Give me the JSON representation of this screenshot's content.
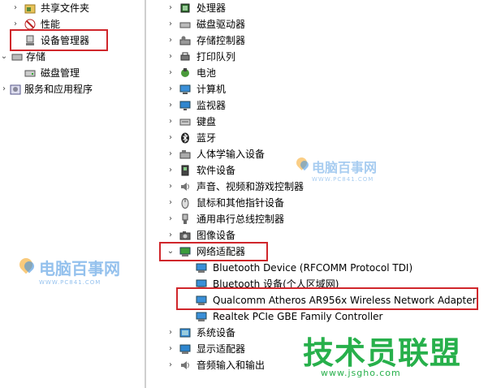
{
  "left_tree": {
    "items": [
      {
        "label": "共享文件夹",
        "icon": "shared-folder-icon",
        "expander": "›"
      },
      {
        "label": "性能",
        "icon": "performance-icon",
        "expander": "›"
      },
      {
        "label": "设备管理器",
        "icon": "device-manager-icon",
        "expander": ""
      },
      {
        "label": "存储",
        "icon": "storage-icon",
        "expander": "⌄"
      },
      {
        "label": "磁盘管理",
        "icon": "disk-management-icon",
        "expander": ""
      },
      {
        "label": "服务和应用程序",
        "icon": "services-icon",
        "expander": "›"
      }
    ]
  },
  "device_tree": {
    "categories": [
      {
        "label": "处理器",
        "icon": "processor-icon",
        "expander": "›"
      },
      {
        "label": "磁盘驱动器",
        "icon": "disk-drive-icon",
        "expander": "›"
      },
      {
        "label": "存储控制器",
        "icon": "storage-controller-icon",
        "expander": "›"
      },
      {
        "label": "打印队列",
        "icon": "print-queue-icon",
        "expander": "›"
      },
      {
        "label": "电池",
        "icon": "battery-icon",
        "expander": "›"
      },
      {
        "label": "计算机",
        "icon": "computer-icon",
        "expander": "›"
      },
      {
        "label": "监视器",
        "icon": "monitor-icon",
        "expander": "›"
      },
      {
        "label": "键盘",
        "icon": "keyboard-icon",
        "expander": "›"
      },
      {
        "label": "蓝牙",
        "icon": "bluetooth-icon",
        "expander": "›"
      },
      {
        "label": "人体学输入设备",
        "icon": "hid-icon",
        "expander": "›"
      },
      {
        "label": "软件设备",
        "icon": "software-device-icon",
        "expander": "›"
      },
      {
        "label": "声音、视频和游戏控制器",
        "icon": "sound-icon",
        "expander": "›"
      },
      {
        "label": "鼠标和其他指针设备",
        "icon": "mouse-icon",
        "expander": "›"
      },
      {
        "label": "通用串行总线控制器",
        "icon": "usb-icon",
        "expander": "›"
      },
      {
        "label": "图像设备",
        "icon": "imaging-icon",
        "expander": "›"
      },
      {
        "label": "网络适配器",
        "icon": "network-adapter-icon",
        "expander": "⌄"
      }
    ],
    "network_children": [
      {
        "label": "Bluetooth Device (RFCOMM Protocol TDI)",
        "icon": "network-adapter-icon"
      },
      {
        "label": "Bluetooth 设备(个人区域网)",
        "icon": "network-adapter-icon"
      },
      {
        "label": "Qualcomm Atheros AR956x Wireless Network Adapter",
        "icon": "network-adapter-icon"
      },
      {
        "label": "Realtek PCIe GBE Family Controller",
        "icon": "network-adapter-icon"
      }
    ],
    "after": [
      {
        "label": "系统设备",
        "icon": "system-device-icon",
        "expander": "›"
      },
      {
        "label": "显示适配器",
        "icon": "display-adapter-icon",
        "expander": "›"
      },
      {
        "label": "音频输入和输出",
        "icon": "audio-io-icon",
        "expander": "›"
      }
    ]
  },
  "watermarks": {
    "brand1": "电脑百事网",
    "brand1_url": "WWW.PC841.COM",
    "brand2": "技术员联盟",
    "brand2_url": "www.jsgho.com"
  },
  "colors": {
    "highlight_red": "#d0262b",
    "wm_blue": "#3d8fe0",
    "wm_green": "#27b04b"
  }
}
